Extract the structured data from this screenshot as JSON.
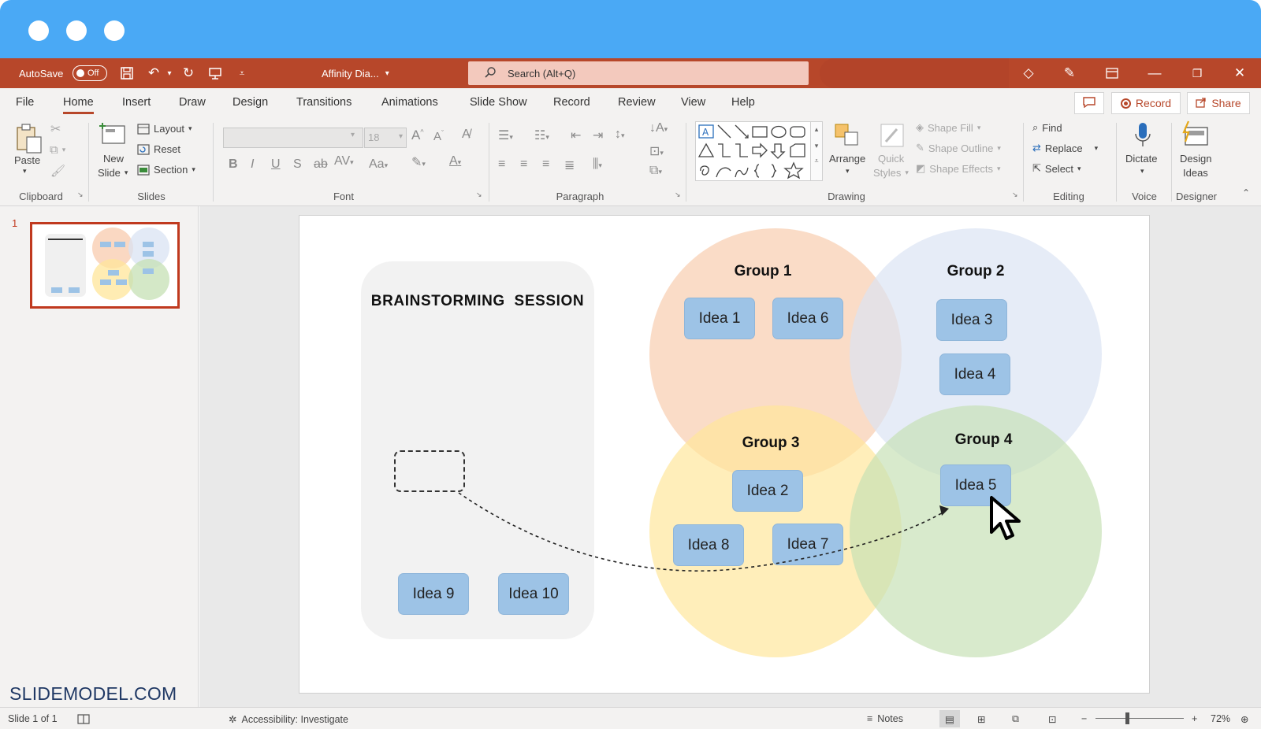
{
  "window": {
    "controls": [
      "close",
      "minimize",
      "maximize"
    ]
  },
  "titlebar": {
    "autosave_label": "AutoSave",
    "autosave_state": "Off",
    "doc_name": "Affinity Dia...",
    "search_placeholder": "Search (Alt+Q)"
  },
  "menu": {
    "tabs": [
      "File",
      "Home",
      "Insert",
      "Draw",
      "Design",
      "Transitions",
      "Animations",
      "Slide Show",
      "Record",
      "Review",
      "View",
      "Help"
    ],
    "active_tab": "Home",
    "record_label": "Record",
    "share_label": "Share"
  },
  "ribbon": {
    "clipboard": {
      "paste": "Paste",
      "label": "Clipboard"
    },
    "slides": {
      "new_slide_1": "New",
      "new_slide_2": "Slide",
      "layout": "Layout",
      "reset": "Reset",
      "section": "Section",
      "label": "Slides"
    },
    "font": {
      "size": "18",
      "label": "Font"
    },
    "paragraph": {
      "label": "Paragraph"
    },
    "drawing": {
      "arrange": "Arrange",
      "quick_styles_1": "Quick",
      "quick_styles_2": "Styles",
      "shape_fill": "Shape Fill",
      "shape_outline": "Shape Outline",
      "shape_effects": "Shape Effects",
      "label": "Drawing"
    },
    "editing": {
      "find": "Find",
      "replace": "Replace",
      "select": "Select",
      "label": "Editing"
    },
    "voice": {
      "dictate": "Dictate",
      "label": "Voice"
    },
    "designer": {
      "design_ideas_1": "Design",
      "design_ideas_2": "Ideas",
      "label": "Designer"
    }
  },
  "thumbnails": {
    "slide_number": "1"
  },
  "slide": {
    "panel_title": "BRAINSTORMING  SESSION",
    "groups": [
      "Group 1",
      "Group 2",
      "Group 3",
      "Group 4"
    ],
    "ideas": {
      "idea1": "Idea 1",
      "idea2": "Idea 2",
      "idea3": "Idea 3",
      "idea4": "Idea 4",
      "idea5": "Idea 5",
      "idea6": "Idea 6",
      "idea7": "Idea 7",
      "idea8": "Idea 8",
      "idea9": "Idea 9",
      "idea10": "Idea 10"
    },
    "colors": {
      "group1": "#f8cbad",
      "group2": "#dae3f3",
      "group3": "#ffe699",
      "group4": "#c5e0b4",
      "idea": "#9dc3e6"
    }
  },
  "watermark": "SLIDEMODEL.COM",
  "status": {
    "slide_info": "Slide 1 of 1",
    "accessibility": "Accessibility: Investigate",
    "notes": "Notes",
    "zoom": "72%"
  }
}
